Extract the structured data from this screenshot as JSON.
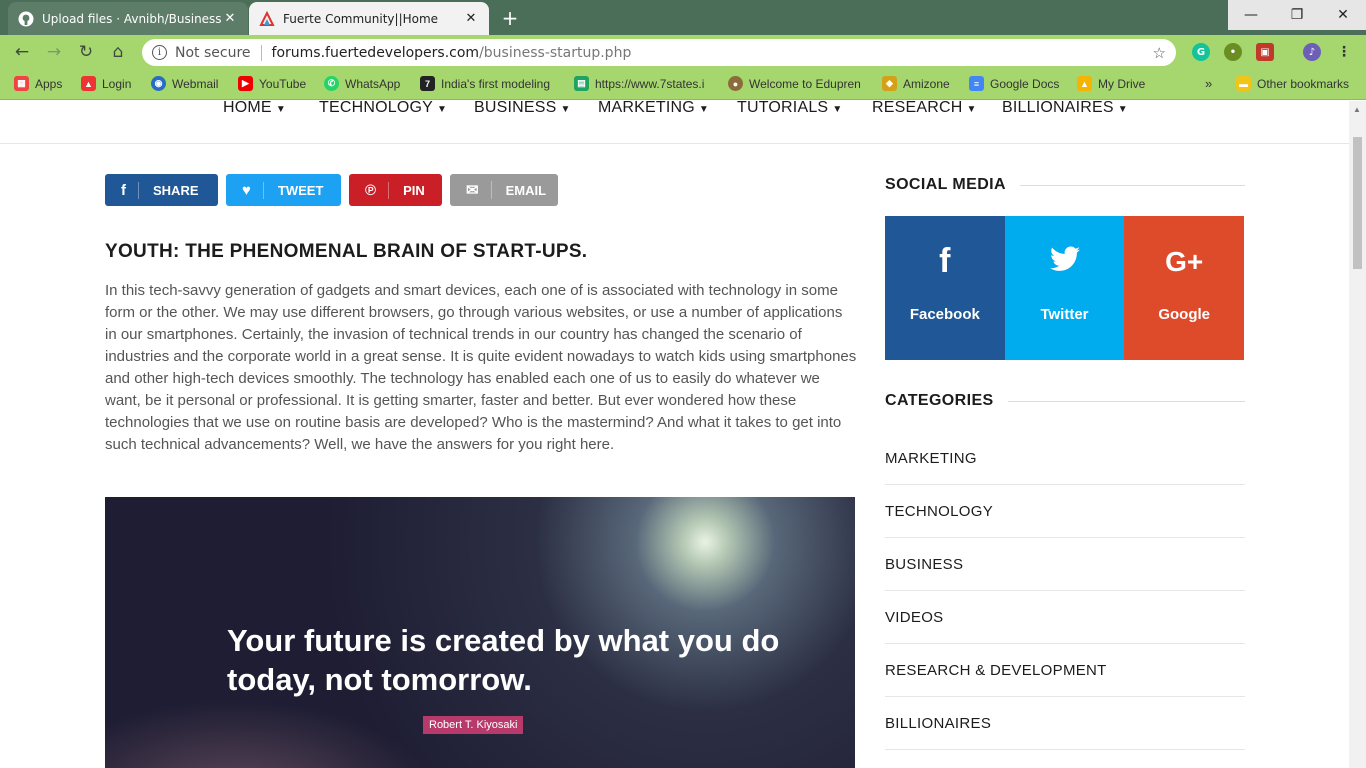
{
  "browser": {
    "tabs": [
      {
        "title": "Upload files · Avnibh/Business-Bl",
        "icon": "github-icon"
      },
      {
        "title": "Fuerte Community||Home",
        "icon": "fuerte-logo-icon"
      }
    ],
    "address": {
      "security": "Not secure",
      "host": "forums.fuertedevelopers.com",
      "path": "/business-startup.php"
    },
    "bookmarks": [
      {
        "label": "Apps",
        "icon": "apps-grid-icon",
        "color": "#e44"
      },
      {
        "label": "Login",
        "icon": "fuerte-logo-icon",
        "color": "#e33"
      },
      {
        "label": "Webmail",
        "icon": "webmail-icon",
        "color": "#2a6cc4"
      },
      {
        "label": "YouTube",
        "icon": "youtube-icon",
        "color": "#e00"
      },
      {
        "label": "WhatsApp",
        "icon": "whatsapp-icon",
        "color": "#25d366"
      },
      {
        "label": "India's first modeling",
        "icon": "seven-logo-icon",
        "color": "#222"
      },
      {
        "label": "https://www.7states.i",
        "icon": "sheets-icon",
        "color": "#1ea362"
      },
      {
        "label": "Welcome to Edupren",
        "icon": "edupren-icon",
        "color": "#8a6d3b"
      },
      {
        "label": "Amizone",
        "icon": "amizone-icon",
        "color": "#d4a017"
      },
      {
        "label": "Google Docs",
        "icon": "google-docs-icon",
        "color": "#4285f4"
      },
      {
        "label": "My Drive",
        "icon": "google-drive-icon",
        "color": "#f4b400"
      },
      {
        "label": "Other bookmarks",
        "icon": "folder-icon",
        "color": "#f0c419"
      }
    ],
    "more_bookmarks": "»"
  },
  "nav": {
    "items": [
      "HOME",
      "TECHNOLOGY",
      "BUSINESS",
      "MARKETING",
      "TUTORIALS",
      "RESEARCH",
      "BILLIONAIRES"
    ]
  },
  "share": [
    {
      "label": "SHARE",
      "icon": "f",
      "color": "#1f5797"
    },
    {
      "label": "TWEET",
      "icon": "🐦",
      "color": "#1da1f2"
    },
    {
      "label": "PIN",
      "icon": "℗",
      "color": "#cb1f27"
    },
    {
      "label": "EMAIL",
      "icon": "✉",
      "color": "#9a9a9a"
    }
  ],
  "article": {
    "title": "YOUTH: THE PHENOMENAL BRAIN OF START-UPS.",
    "body": "In this tech-savvy generation of gadgets and smart devices, each one of is associated with technology in some form or the other. We may use different browsers, go through various websites, or use a number of applications in our smartphones. Certainly, the invasion of technical trends in our country has changed the scenario of industries and the corporate world in a great sense. It is quite evident nowadays to watch kids using smartphones and other high-tech devices smoothly. The technology has enabled each one of us to easily do whatever we want, be it personal or professional. It is getting smarter, faster and better. But ever wondered how these technologies that we use on routine basis are developed? Who is the mastermind? And what it takes to get into such technical advancements? Well, we have the answers for you right here.",
    "quote": "Your future is created by what you do today, not tomorrow.",
    "quote_author": "Robert T. Kiyosaki"
  },
  "sidebar": {
    "social_title": "SOCIAL MEDIA",
    "social": [
      {
        "label": "Facebook",
        "icon": "f",
        "color": "#1f5797"
      },
      {
        "label": "Twitter",
        "icon": "🐦",
        "color": "#00acee"
      },
      {
        "label": "Google",
        "icon": "G+",
        "color": "#dd4b2b"
      }
    ],
    "categories_title": "CATEGORIES",
    "categories": [
      "MARKETING",
      "TECHNOLOGY",
      "BUSINESS",
      "VIDEOS",
      "RESEARCH & DEVELOPMENT",
      "BILLIONAIRES"
    ]
  }
}
